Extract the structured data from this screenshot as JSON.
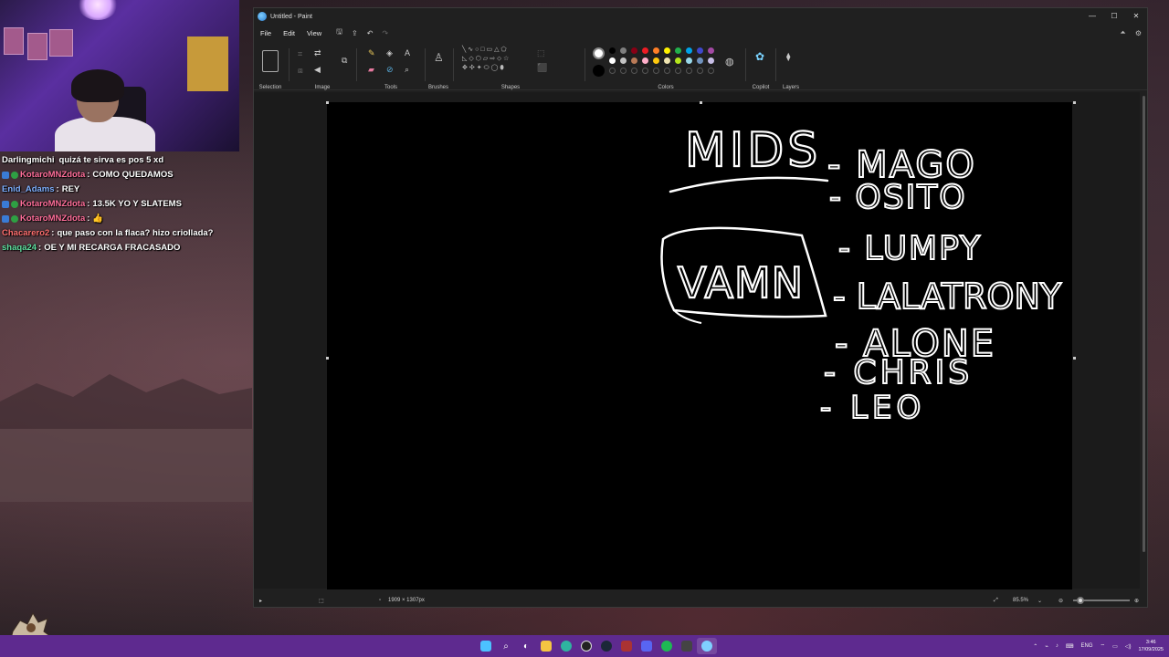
{
  "window": {
    "title": "Untitled - Paint",
    "controls": [
      "—",
      "☐",
      "✕"
    ]
  },
  "menu": {
    "file": "File",
    "edit": "Edit",
    "view": "View"
  },
  "ribbon": {
    "selection": "Selection",
    "image": "Image",
    "tools": "Tools",
    "brushes": "Brushes",
    "shapes": "Shapes",
    "colors": "Colors",
    "copilot": "Copilot",
    "layers": "Layers"
  },
  "palette": {
    "row1": [
      "#000000",
      "#7f7f7f",
      "#880015",
      "#ed1c24",
      "#ff7f27",
      "#fff200",
      "#22b14c",
      "#00a2e8",
      "#3f48cc",
      "#a349a4"
    ],
    "row2": [
      "#ffffff",
      "#c3c3c3",
      "#b97a57",
      "#ffaec9",
      "#ffc90e",
      "#efe4b0",
      "#b5e61d",
      "#99d9ea",
      "#7092be",
      "#c8bfe7"
    ],
    "primary": "#ffffff",
    "secondary": "#000000"
  },
  "drawing": {
    "heading": "MIDS",
    "boxed": "VAMN",
    "names": [
      "- MAGO",
      "- OSITO",
      "- LUMPY",
      "- LALATRONY",
      "- ALONE",
      "- CHRIS",
      "- LEO"
    ]
  },
  "status": {
    "canvas_size": "1909 × 1307px",
    "zoom": "85.5%"
  },
  "chat": [
    {
      "user": "Darlingmichi",
      "user_color": "#ffffff",
      "badges": false,
      "text": "quizá te sirva es pos 5 xd",
      "sep": ""
    },
    {
      "user": "KotaroMNZdota",
      "user_color": "#ff6e9a",
      "badges": true,
      "text": "COMO QUEDAMOS",
      "sep": ":"
    },
    {
      "user": "Enid_Adams",
      "user_color": "#7fb0ff",
      "badges": false,
      "text": "REY",
      "sep": ":"
    },
    {
      "user": "KotaroMNZdota",
      "user_color": "#ff6e9a",
      "badges": true,
      "text": "13.5K YO Y SLATEMS",
      "sep": ":"
    },
    {
      "user": "KotaroMNZdota",
      "user_color": "#ff6e9a",
      "badges": true,
      "text": "👍",
      "sep": ":"
    },
    {
      "user": "Chacarero2",
      "user_color": "#ff6e6e",
      "badges": false,
      "text": "que paso con la flaca? hizo criollada?",
      "sep": ":"
    },
    {
      "user": "shaqa24",
      "user_color": "#5fe0a0",
      "badges": false,
      "text": "OE Y MI RECARGA FRACASADO",
      "sep": ":"
    }
  ],
  "taskbar": {
    "lang": "ENG",
    "time": "3:46",
    "date": "17/09/2025"
  }
}
